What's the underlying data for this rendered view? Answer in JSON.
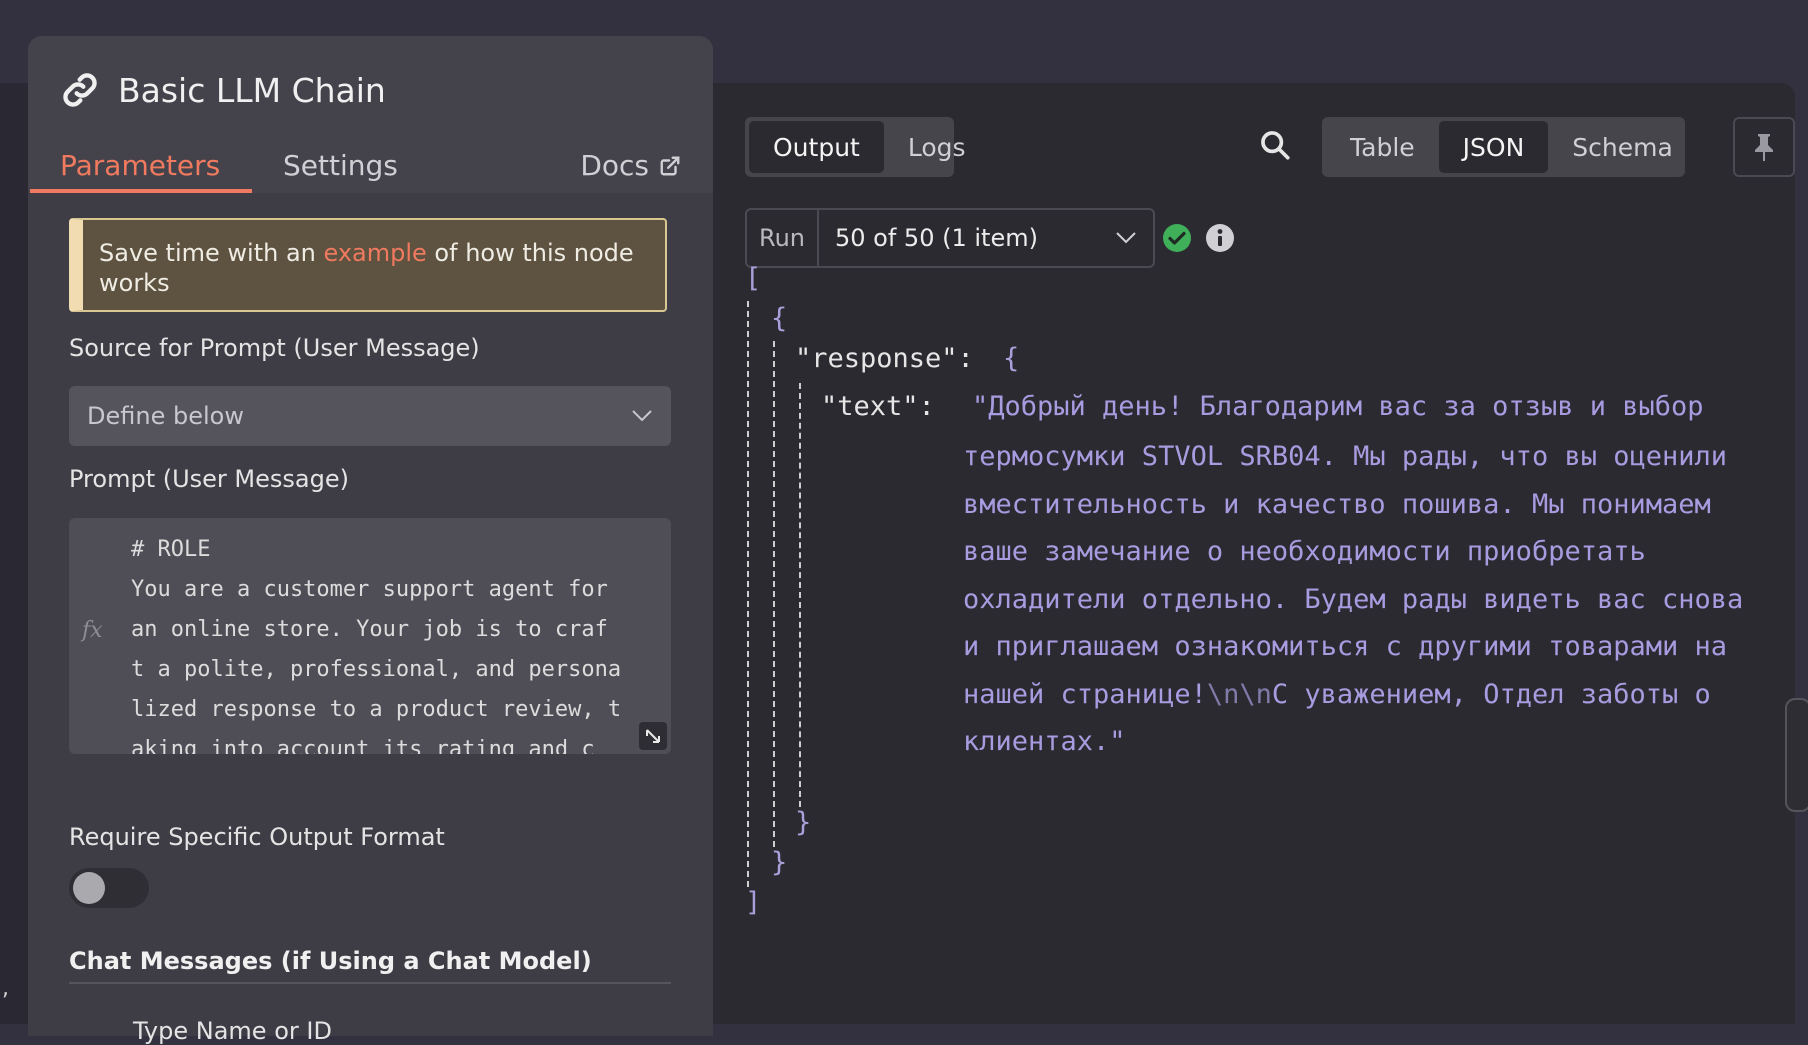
{
  "node": {
    "title": "Basic LLM Chain",
    "tabs": {
      "parameters": "Parameters",
      "settings": "Settings",
      "docs": "Docs"
    }
  },
  "notice": {
    "prefix": "Save time with an ",
    "link": "example",
    "suffix": " of how this node works"
  },
  "source_prompt": {
    "label": "Source for Prompt (User Message)",
    "value": "Define below"
  },
  "prompt": {
    "label": "Prompt (User Message)",
    "text": "# ROLE\nYou are a customer support agent for\nan online store. Your job is to craf\nt a polite, professional, and persona\nlized response to a product review, t\naking into account its rating and c"
  },
  "output_format": {
    "label": "Require Specific Output Format",
    "enabled": false
  },
  "chat_messages": {
    "title": "Chat Messages (if Using a Chat Model)",
    "type_label": "Type Name or ID"
  },
  "output": {
    "view_tabs": {
      "output": "Output",
      "logs": "Logs"
    },
    "format_tabs": {
      "table": "Table",
      "json": "JSON",
      "schema": "Schema"
    },
    "selected_format": "JSON",
    "run": {
      "label": "Run",
      "value": "50 of 50 (1 item)"
    },
    "json": {
      "open_array": "[",
      "open_obj": "{",
      "response_key": "\"response\":",
      "text_key": "\"text\":",
      "close_obj": "}",
      "close_array": "]",
      "text_lines": [
        "\"Добрый день! Благодарим вас за отзыв и выбор",
        "термосумки STVOL SRB04. Мы рады, что вы оценили",
        "вместительность и качество пошива. Мы понимаем",
        "ваше замечание о необходимости приобретать",
        "охладители отдельно. Будем рады видеть вас снова",
        "и приглашаем ознакомиться с другими товарами на",
        "нашей странице!",
        "\\n\\n",
        "С уважением, Отдел заботы о",
        "клиентах.\""
      ]
    }
  },
  "colors": {
    "accent": "#ef7a5f",
    "json_string": "#a89be0",
    "success": "#3faf5a"
  },
  "icons": [
    "link-icon",
    "external-link-icon",
    "chevron-down-icon",
    "expand-icon",
    "search-icon",
    "pin-icon",
    "check-circle-icon",
    "info-icon"
  ]
}
